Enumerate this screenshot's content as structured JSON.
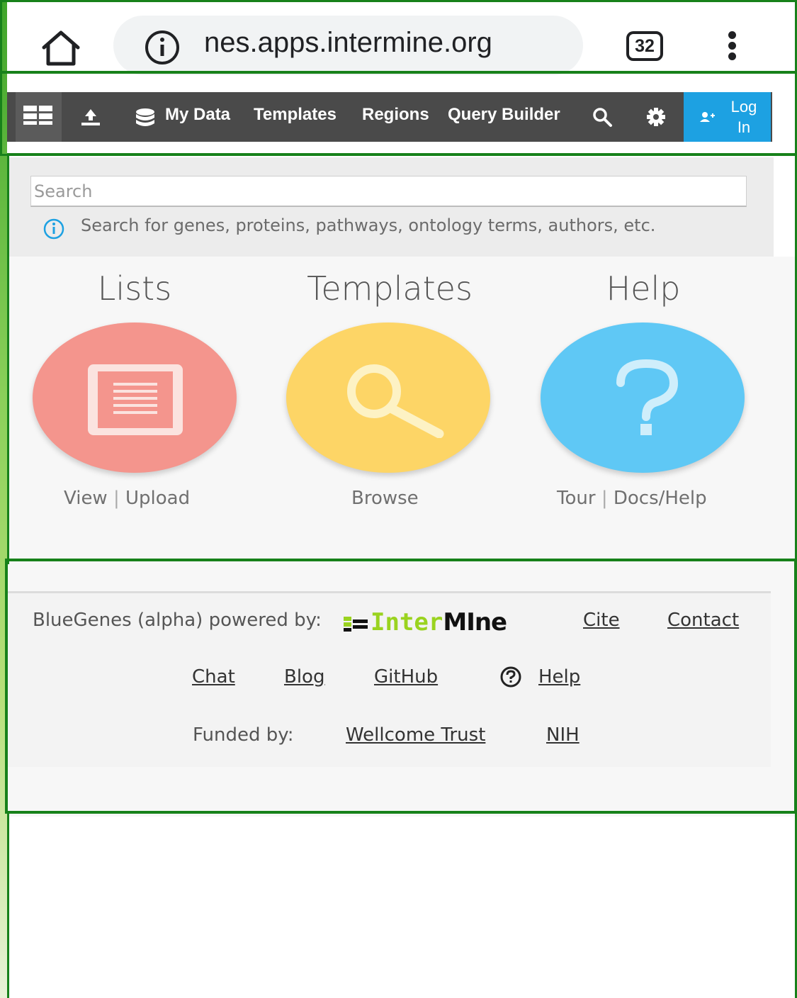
{
  "browser": {
    "url": "nes.apps.intermine.org",
    "tab_count": "32"
  },
  "nav": {
    "items": [
      "My Data",
      "Templates",
      "Regions",
      "Query Builder"
    ],
    "login_line1": "Log",
    "login_line2": "In"
  },
  "search": {
    "placeholder": "Search",
    "hint": "Search for genes, proteins, pathways, ontology terms, authors, etc."
  },
  "sections": [
    {
      "title": "Lists",
      "link1": "View",
      "separator": "|",
      "link2": "Upload",
      "color": "#f4958d",
      "icon": "list-icon"
    },
    {
      "title": "Templates",
      "link1": "Browse",
      "color": "#fdd566",
      "icon": "magnifier-icon"
    },
    {
      "title": "Help",
      "link1": "Tour",
      "separator": "|",
      "link2": "Docs/Help",
      "color": "#5fc8f5",
      "icon": "question-icon"
    }
  ],
  "footer": {
    "powered_by": "BlueGenes (alpha) powered by:",
    "logo_part1": "Inter",
    "logo_part2": "MIne",
    "cite": "Cite",
    "contact": "Contact",
    "chat": "Chat",
    "blog": "Blog",
    "github": "GitHub",
    "help": "Help",
    "funded_by": "Funded by:",
    "wellcome": "Wellcome Trust",
    "nih": "NIH"
  },
  "colors": {
    "nav_bg": "#4a4a4a",
    "login_bg": "#1da1e2",
    "logo_green": "#9ad31f",
    "overlay_green": "#17811a"
  }
}
